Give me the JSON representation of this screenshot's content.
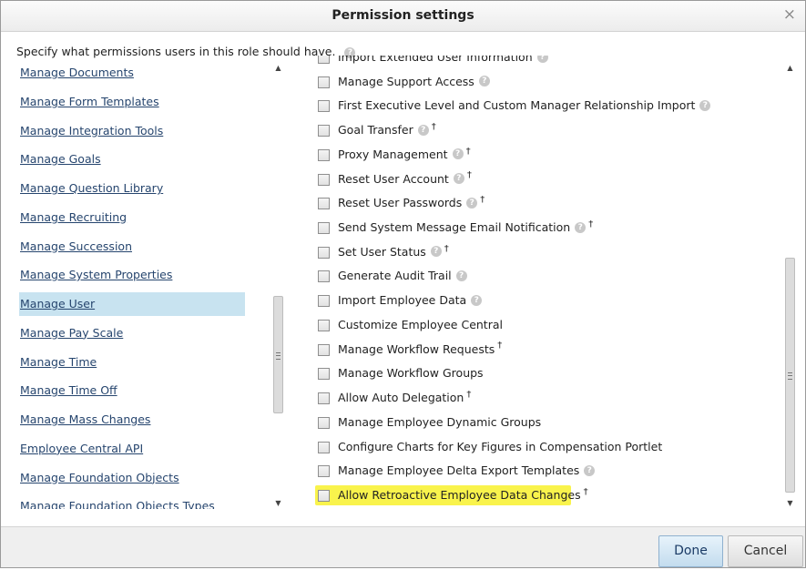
{
  "dialog": {
    "title": "Permission settings",
    "close_glyph": "×",
    "intro_text": "Specify what permissions users in this role should have.",
    "help_glyph": "?",
    "dagger_glyph": "†"
  },
  "left_list": {
    "items": [
      {
        "label": "Manage Documents",
        "selected": false
      },
      {
        "label": "Manage Form Templates",
        "selected": false
      },
      {
        "label": "Manage Integration Tools",
        "selected": false
      },
      {
        "label": "Manage Goals",
        "selected": false
      },
      {
        "label": "Manage Question Library",
        "selected": false
      },
      {
        "label": "Manage Recruiting",
        "selected": false
      },
      {
        "label": "Manage Succession",
        "selected": false
      },
      {
        "label": "Manage System Properties",
        "selected": false
      },
      {
        "label": "Manage User",
        "selected": true
      },
      {
        "label": "Manage Pay Scale",
        "selected": false
      },
      {
        "label": "Manage Time",
        "selected": false
      },
      {
        "label": "Manage Time Off",
        "selected": false
      },
      {
        "label": "Manage Mass Changes",
        "selected": false
      },
      {
        "label": "Employee Central API",
        "selected": false
      },
      {
        "label": "Manage Foundation Objects",
        "selected": false
      },
      {
        "label": "Manage Foundation Objects Types",
        "selected": false
      }
    ]
  },
  "permissions": {
    "items": [
      {
        "label": "Import Extended User Information",
        "help": true,
        "dagger": false,
        "checked": false,
        "highlighted": false
      },
      {
        "label": "Manage Support Access",
        "help": true,
        "dagger": false,
        "checked": false,
        "highlighted": false
      },
      {
        "label": "First Executive Level and Custom Manager Relationship Import",
        "help": true,
        "dagger": false,
        "checked": false,
        "highlighted": false
      },
      {
        "label": "Goal Transfer",
        "help": true,
        "dagger": true,
        "checked": false,
        "highlighted": false
      },
      {
        "label": "Proxy Management",
        "help": true,
        "dagger": true,
        "checked": false,
        "highlighted": false
      },
      {
        "label": "Reset User Account",
        "help": true,
        "dagger": true,
        "checked": false,
        "highlighted": false
      },
      {
        "label": "Reset User Passwords",
        "help": true,
        "dagger": true,
        "checked": false,
        "highlighted": false
      },
      {
        "label": "Send System Message Email Notification",
        "help": true,
        "dagger": true,
        "checked": false,
        "highlighted": false
      },
      {
        "label": "Set User Status",
        "help": true,
        "dagger": true,
        "checked": false,
        "highlighted": false
      },
      {
        "label": "Generate Audit Trail",
        "help": true,
        "dagger": false,
        "checked": false,
        "highlighted": false
      },
      {
        "label": "Import Employee Data",
        "help": true,
        "dagger": false,
        "checked": false,
        "highlighted": false
      },
      {
        "label": "Customize Employee Central",
        "help": false,
        "dagger": false,
        "checked": false,
        "highlighted": false
      },
      {
        "label": "Manage Workflow Requests",
        "help": false,
        "dagger": true,
        "checked": false,
        "highlighted": false
      },
      {
        "label": "Manage Workflow Groups",
        "help": false,
        "dagger": false,
        "checked": false,
        "highlighted": false
      },
      {
        "label": "Allow Auto Delegation",
        "help": false,
        "dagger": true,
        "checked": false,
        "highlighted": false
      },
      {
        "label": "Manage Employee Dynamic Groups",
        "help": false,
        "dagger": false,
        "checked": false,
        "highlighted": false
      },
      {
        "label": "Configure Charts for Key Figures in Compensation Portlet",
        "help": false,
        "dagger": false,
        "checked": false,
        "highlighted": false
      },
      {
        "label": "Manage Employee Delta Export Templates",
        "help": true,
        "dagger": false,
        "checked": false,
        "highlighted": false
      },
      {
        "label": "Allow Retroactive Employee Data Changes",
        "help": false,
        "dagger": true,
        "checked": false,
        "highlighted": true
      }
    ]
  },
  "footer": {
    "done_label": "Done",
    "cancel_label": "Cancel"
  },
  "colors": {
    "selected_row": "#c8e3f0",
    "highlight": "#f9f34c",
    "link": "#26456e"
  },
  "scrollbars": {
    "arrow_up": "▲",
    "arrow_down": "▼"
  }
}
